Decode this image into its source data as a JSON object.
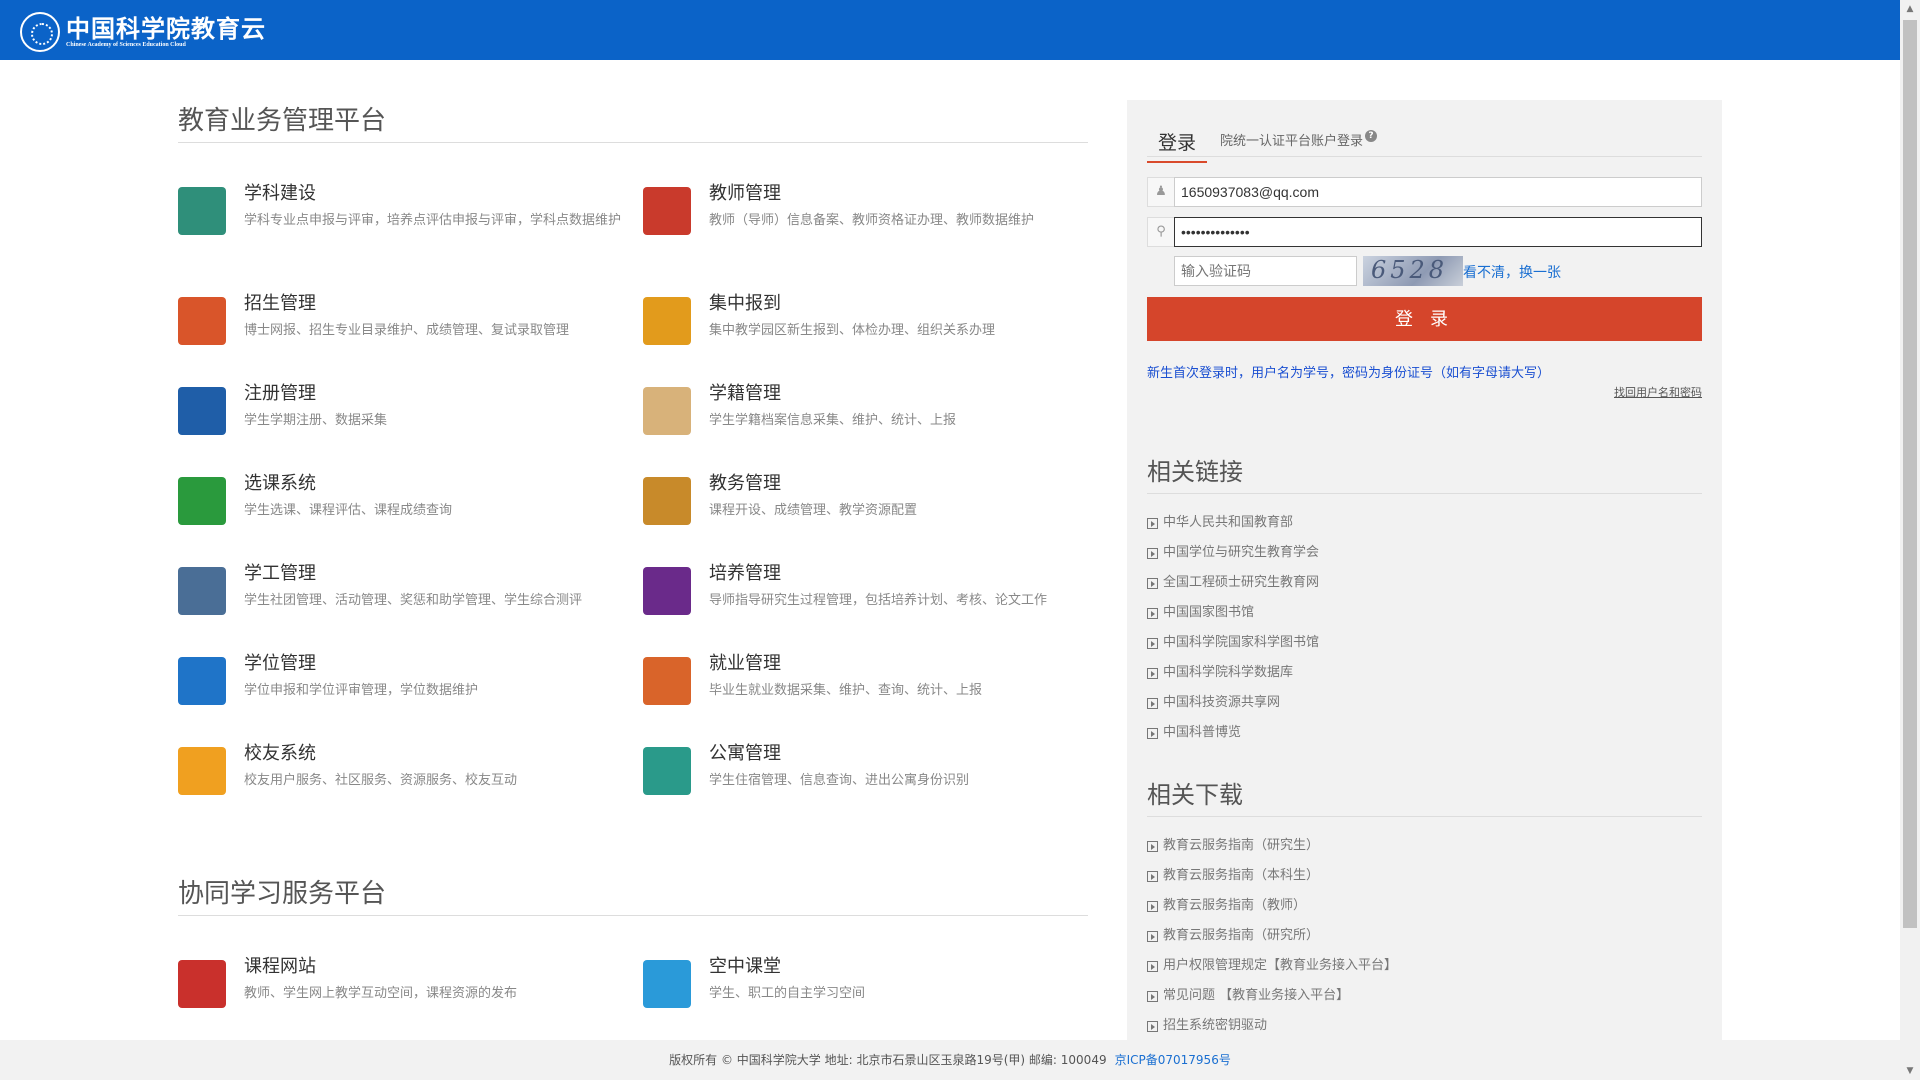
{
  "header": {
    "logo_cn": "中国科学院教育云",
    "logo_en": "Chinese Academy of Sciences Education Cloud"
  },
  "platform1": {
    "title": "教育业务管理平台",
    "modules": [
      {
        "title": "学科建设",
        "desc": "学科专业点申报与评审，培养点评估申报与评审，学科点数据维护",
        "icon": "book-pen-icon",
        "color": "#2f8f7a"
      },
      {
        "title": "教师管理",
        "desc": "教师（导师）信息备案、教师资格证办理、教师数据维护",
        "icon": "teacher-icon",
        "color": "#c93a2c"
      },
      {
        "title": "招生管理",
        "desc": "博士网报、招生专业目录维护、成绩管理、复试录取管理",
        "icon": "enrollment-icon",
        "color": "#d9552a"
      },
      {
        "title": "集中报到",
        "desc": "集中教学园区新生报到、体检办理、组织关系办理",
        "icon": "checkin-icon",
        "color": "#e29b1c"
      },
      {
        "title": "注册管理",
        "desc": "学生学期注册、数据采集",
        "icon": "id-card-icon",
        "color": "#1f5ea8"
      },
      {
        "title": "学籍管理",
        "desc": "学生学籍档案信息采集、维护、统计、上报",
        "icon": "archive-icon",
        "color": "#d8b27a"
      },
      {
        "title": "选课系统",
        "desc": "学生选课、课程评估、课程成绩查询",
        "icon": "course-select-icon",
        "color": "#2a9a3d"
      },
      {
        "title": "教务管理",
        "desc": "课程开设、成绩管理、教学资源配置",
        "icon": "lightbulb-icon",
        "color": "#c88a2a"
      },
      {
        "title": "学工管理",
        "desc": "学生社团管理、活动管理、奖惩和助学管理、学生综合测评",
        "icon": "user-gear-icon",
        "color": "#4a6e96"
      },
      {
        "title": "培养管理",
        "desc": "导师指导研究生过程管理，包括培养计划、考核、论文工作",
        "icon": "head-gear-icon",
        "color": "#6a2a8a"
      },
      {
        "title": "学位管理",
        "desc": "学位申报和学位评审管理，学位数据维护",
        "icon": "graduation-cap-icon",
        "color": "#1f74c8"
      },
      {
        "title": "就业管理",
        "desc": "毕业生就业数据采集、维护、查询、统计、上报",
        "icon": "briefcase-icon",
        "color": "#d9642a"
      },
      {
        "title": "校友系统",
        "desc": "校友用户服务、社区服务、资源服务、校友互动",
        "icon": "alumni-network-icon",
        "color": "#f0a020"
      },
      {
        "title": "公寓管理",
        "desc": "学生住宿管理、信息查询、进出公寓身份识别",
        "icon": "apartment-icon",
        "color": "#2a9a8a"
      }
    ]
  },
  "platform2": {
    "title": "协同学习服务平台",
    "modules": [
      {
        "title": "课程网站",
        "desc": "教师、学生网上教学互动空间，课程资源的发布",
        "icon": "course-site-icon",
        "color": "#c9302c"
      },
      {
        "title": "空中课堂",
        "desc": "学生、职工的自主学习空间",
        "icon": "cloud-classroom-icon",
        "color": "#2a9ad9"
      }
    ]
  },
  "login": {
    "tab_login": "登录",
    "tab_unified": "院统一认证平台账户登录",
    "username_value": "1650937083@qq.com",
    "password_value": "••••••••••••••",
    "captcha_placeholder": "输入验证码",
    "captcha_text": "6528",
    "captcha_refresh": "看不清，换一张",
    "button": "登 录",
    "notice": "新生首次登录时，用户名为学号，密码为身份证号（如有字母请大写）",
    "forgot": "找回用户名和密码"
  },
  "related_links": {
    "title": "相关链接",
    "items": [
      "中华人民共和国教育部",
      "中国学位与研究生教育学会",
      "全国工程硕士研究生教育网",
      "中国国家图书馆",
      "中国科学院国家科学图书馆",
      "中国科学院科学数据库",
      "中国科技资源共享网",
      "中国科普博览"
    ]
  },
  "downloads": {
    "title": "相关下载",
    "items": [
      "教育云服务指南（研究生）",
      "教育云服务指南（本科生）",
      "教育云服务指南（教师）",
      "教育云服务指南（研究所）",
      "用户权限管理规定【教育业务接入平台】",
      "常见问题 【教育业务接入平台】",
      "招生系统密钥驱动"
    ]
  },
  "footer": {
    "copyright": "版权所有 © 中国科学院大学 地址: 北京市石景山区玉泉路19号(甲) 邮编: 100049",
    "icp": "京ICP备07017956号"
  }
}
